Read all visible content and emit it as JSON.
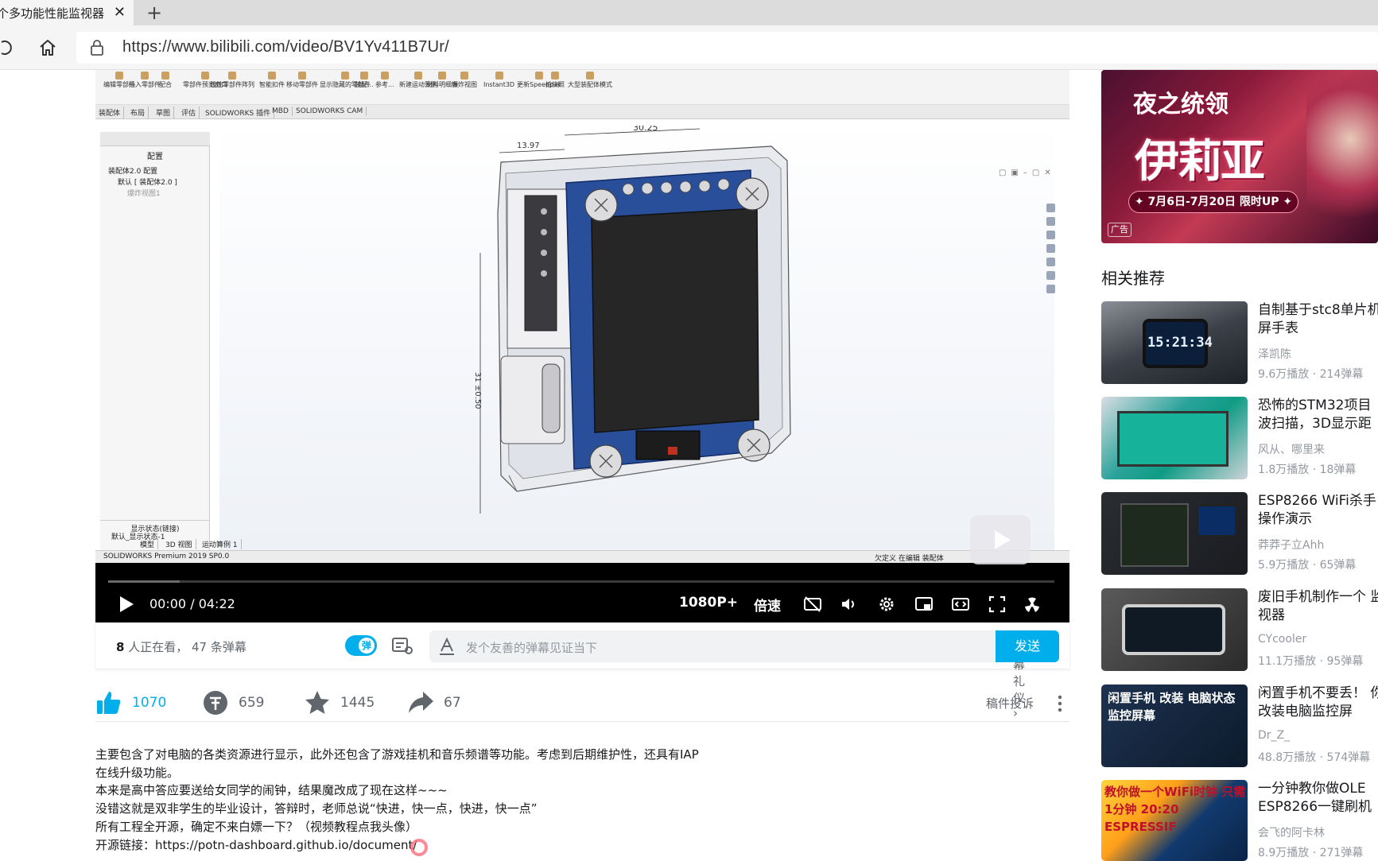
{
  "browser": {
    "tab_title": "个多功能性能监视器",
    "tab_close": "✕",
    "new_tab": "+",
    "url": "https://www.bilibili.com/video/BV1Yv411B7Ur/"
  },
  "solidworks": {
    "toolbar": [
      "编辑零部件",
      "插入零部件",
      "配合",
      "零部件预览窗口",
      "线性零部件阵列",
      "智能扣件",
      "移动零部件",
      "显示隐藏的零部件",
      "装配...",
      "参考...",
      "新建运动算例",
      "材料明细表",
      "爆炸视图",
      "Instant3D",
      "更新Speedpak",
      "拍快照",
      "大型装配体模式"
    ],
    "tabs": [
      "装配体",
      "布局",
      "草图",
      "评估",
      "SOLIDWORKS 插件",
      "MBD",
      "SOLIDWORKS CAM"
    ],
    "tree_header": "配置",
    "tree_items": [
      "装配体2.0 配置",
      "默认 [ 装配体2.0 ]",
      "爆炸视图1"
    ],
    "display_state_header": "显示状态(链接)",
    "display_state_item": "默认_显示状态-1",
    "bottom_tabs": [
      "模型",
      "3D 视图",
      "运动算例 1"
    ],
    "status_left": "SOLIDWORKS Premium 2019 SP0.0",
    "status_right": "欠定义   在编辑 装配体",
    "dimensions": [
      "13.97",
      "30.25",
      "31 ±0.50"
    ]
  },
  "player": {
    "current_time": "00:00",
    "time_sep": "/",
    "duration": "04:22",
    "quality": "1080P+",
    "speed": "倍速",
    "progress": 0.0
  },
  "danmaku": {
    "viewers_count": "8",
    "viewers_label": "人正在看，",
    "danmaku_count": "47 条弹幕",
    "toggle_label": "弹",
    "placeholder": "发个友善的弹幕见证当下",
    "etiquette": "弹幕礼仪 ›",
    "send": "发送"
  },
  "actions": {
    "likes": "1070",
    "coins": "659",
    "favorites": "1445",
    "shares": "67",
    "report": "稿件投诉"
  },
  "description": [
    "主要包含了对电脑的各类资源进行显示，此外还包含了游戏挂机和音乐频谱等功能。考虑到后期维护性，还具有IAP在线升级功能。",
    "本来是高中答应要送给女同学的闹钟，结果魔改成了现在这样~~~",
    "没错这就是双非学生的毕业设计，答辩时，老师总说“快进，快一点，快进，快一点”",
    "所有工程全开源，确定不来白嫖一下？（视频教程点我头像）",
    "开源链接：https://potn-dashboard.github.io/document/"
  ],
  "ad": {
    "subtitle": "夜之统领",
    "title": "伊莉亚",
    "date": "✦ 7月6日-7月20日 限时UP ✦",
    "badge": "广告"
  },
  "recommend": {
    "heading": "相关推荐",
    "items": [
      {
        "title": "自制基于stc8单片机屏手表",
        "author": "泽凯陈",
        "stats": "9.6万播放 · 214弹幕",
        "thumb_text": "15:21:34"
      },
      {
        "title": "恐怖的STM32项目 波扫描，3D显示距",
        "author": "风从、哪里来",
        "stats": "1.8万播放 · 18弹幕",
        "thumb_text": ""
      },
      {
        "title": "ESP8266 WiFi杀手 操作演示",
        "author": "莽莽子立Ahh",
        "stats": "5.9万播放 · 65弹幕",
        "thumb_text": ""
      },
      {
        "title": "废旧手机制作一个 监视器",
        "author": "CYcooler",
        "stats": "11.1万播放 · 95弹幕",
        "thumb_text": ""
      },
      {
        "title": "闲置手机不要丢！ 你改装电脑监控屏",
        "author": "Dr_Z_",
        "stats": "48.8万播放 · 574弹幕",
        "thumb_text": "闲置手机 改装 电脑状态 监控屏幕"
      },
      {
        "title": "一分钟教你做OLE ESP8266一键刷机",
        "author": "会飞的阿卡林",
        "stats": "8.9万播放 · 271弹幕",
        "thumb_text": "教你做一个WiFi时钟 只需1分钟 20:20 ESPRESSIF"
      }
    ]
  },
  "colors": {
    "accent": "#00aeec",
    "text_secondary": "#61666d",
    "text_muted": "#9499a0"
  }
}
